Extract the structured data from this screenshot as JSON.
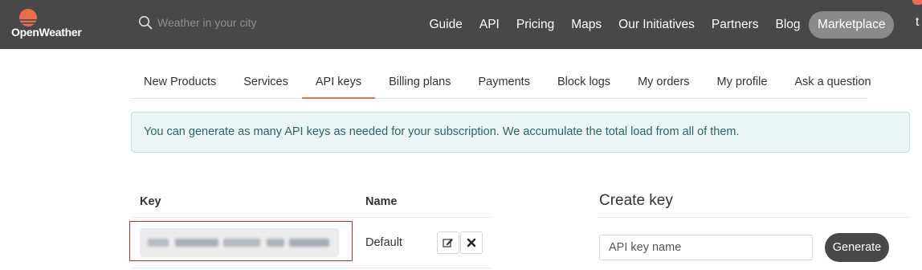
{
  "header": {
    "logo_text": "OpenWeather",
    "search_placeholder": "Weather in your city",
    "nav": [
      "Guide",
      "API",
      "Pricing",
      "Maps",
      "Our Initiatives",
      "Partners",
      "Blog"
    ],
    "marketplace_label": "Marketplace",
    "user_initial": "t",
    "colors": {
      "bar": "#48484a",
      "accent": "#e96e50"
    }
  },
  "tabs": {
    "items": [
      "New Products",
      "Services",
      "API keys",
      "Billing plans",
      "Payments",
      "Block logs",
      "My orders",
      "My profile",
      "Ask a question"
    ],
    "active": "API keys"
  },
  "alert": {
    "text": "You can generate as many API keys as needed for your subscription. We accumulate the total load from all of them."
  },
  "keys_table": {
    "headers": {
      "key": "Key",
      "name": "Name"
    },
    "rows": [
      {
        "key_value": "",
        "name": "Default"
      }
    ],
    "row_icons": [
      "edit-icon",
      "delete-icon"
    ]
  },
  "create_key": {
    "title": "Create key",
    "input_placeholder": "API key name",
    "button_label": "Generate"
  }
}
